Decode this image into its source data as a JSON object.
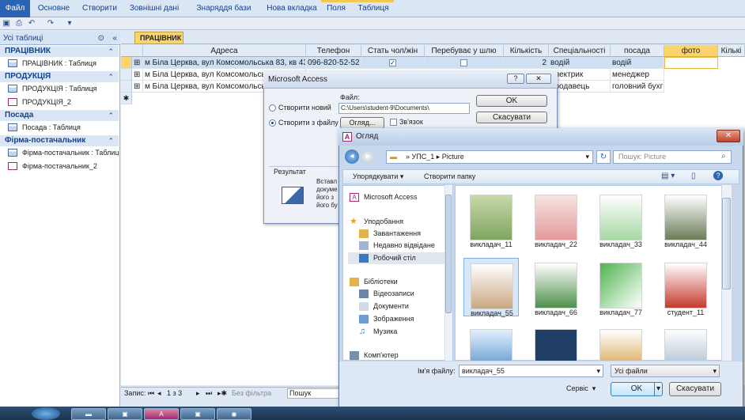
{
  "ribbon": {
    "file": "Файл",
    "tabs": [
      "Основне",
      "Створити",
      "Зовнішні дані",
      "Знаряддя бази даних",
      "Нова вкладка",
      "Поля",
      "Таблиця"
    ]
  },
  "nav": {
    "header": "Усі таблиці",
    "groups": [
      {
        "name": "ПРАЦІВНИК",
        "items": [
          "ПРАЦІВНИК : Таблиця"
        ]
      },
      {
        "name": "ПРОДУКЦІЯ",
        "items": [
          "ПРОДУКЦІЯ : Таблиця",
          "ПРОДУКЦІЯ_2"
        ]
      },
      {
        "name": "Посада",
        "items": [
          "Посада : Таблиця"
        ]
      },
      {
        "name": "Фірма-постачальник",
        "items": [
          "Фірма-постачальник : Таблиця",
          "Фірма-постачальник_2"
        ]
      }
    ]
  },
  "doc": {
    "tab": "ПРАЦІВНИК",
    "columns": [
      "Адреса",
      "Телефон",
      "Стать чол/жін",
      "Перебуває у шлю",
      "Кількість",
      "Спеціальності",
      "посада",
      "фото",
      "Кількі"
    ],
    "rows": [
      {
        "addr": "м Біла Церква, вул Комсомольська 83, кв 43",
        "phone": "096-820-52-52",
        "qty": "2",
        "spec": "водій",
        "pos": "водій"
      },
      {
        "addr": "м Біла Церква, вул Комсомольська 10",
        "phone": "",
        "qty": "",
        "spec": "електрик",
        "pos": "менеджер"
      },
      {
        "addr": "м Біла Церква, вул Комсомольська",
        "phone": "",
        "qty": "",
        "spec": "продавець",
        "pos": "головний бухг"
      }
    ],
    "record": {
      "label": "Запис:",
      "nav": "1 з 3",
      "filter": "Без фільтра",
      "search": "Пошук"
    }
  },
  "access_dialog": {
    "title": "Microsoft Access",
    "create_new": "Створити новий",
    "create_from_file": "Створити з файлу",
    "file_label": "Файл:",
    "file_path": "C:\\Users\\student-9\\Documents\\",
    "browse": "Огляд...",
    "link": "Зв'язок",
    "ok": "OK",
    "cancel": "Скасувати",
    "result": "Результат",
    "result_text": [
      "Вставл",
      "докуме",
      "його з",
      "його бу"
    ]
  },
  "open_dialog": {
    "title": "Огляд",
    "path": [
      "УПС_1",
      "Picture"
    ],
    "search_placeholder": "Пошук: Picture",
    "organize": "Упорядкувати",
    "new_folder": "Створити папку",
    "tree": [
      "Microsoft Access",
      "Уподобання",
      "Завантаження",
      "Недавно відвідане",
      "Робочий стіл",
      "Бібліотеки",
      "Відеозаписи",
      "Документи",
      "Зображення",
      "Музика",
      "Комп'ютер"
    ],
    "files": [
      "викладач_11",
      "викладач_22",
      "викладач_33",
      "викладач_44",
      "викладач_55",
      "викладач_66",
      "викладач_77",
      "студент_11",
      "",
      "",
      "",
      ""
    ],
    "filename_label": "Ім'я файлу:",
    "filename": "викладач_55",
    "filetype": "Усі файли",
    "service": "Сервіс",
    "ok": "OK",
    "cancel": "Скасувати"
  },
  "colors": {
    "accent": "#2a63b5",
    "selected_tab": "#fbd56b"
  }
}
